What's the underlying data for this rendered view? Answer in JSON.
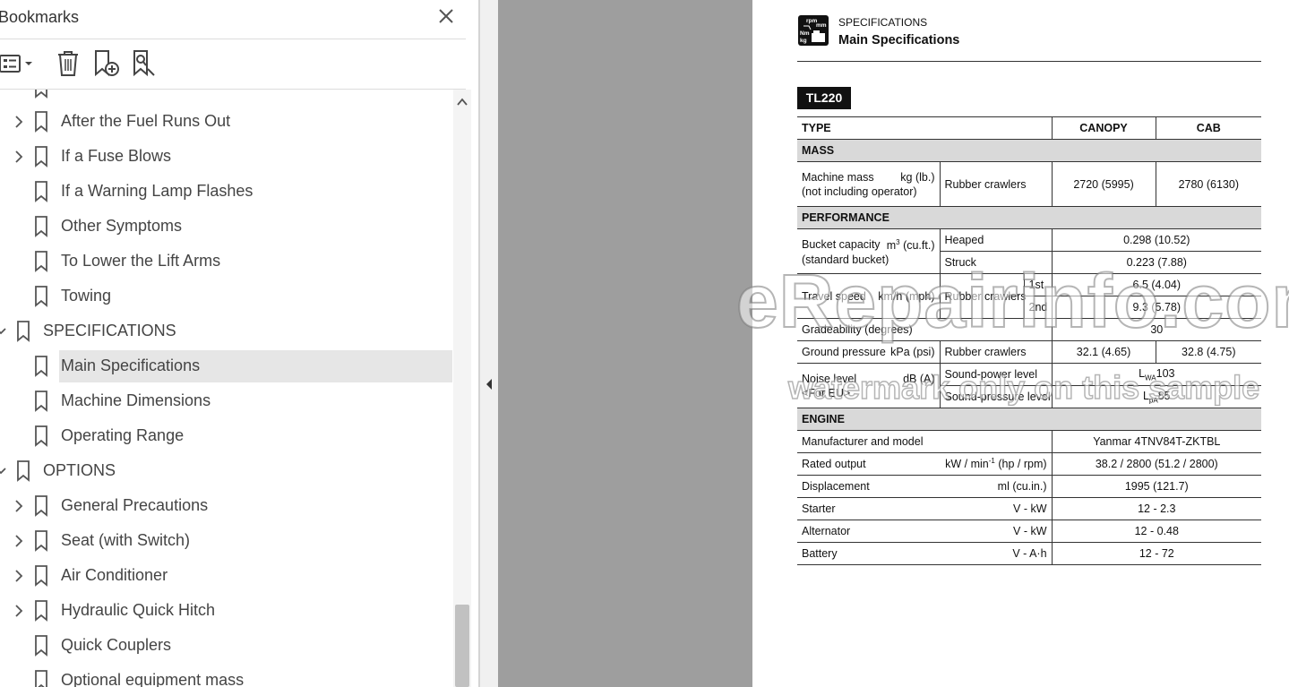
{
  "bookmarks_panel": {
    "title": "Bookmarks",
    "items": [
      {
        "label": "After the Fuel Runs Out",
        "level": 1,
        "expandable": true,
        "expanded": false,
        "selected": false
      },
      {
        "label": "If a Fuse Blows",
        "level": 1,
        "expandable": true,
        "expanded": false,
        "selected": false
      },
      {
        "label": "If a Warning Lamp Flashes",
        "level": 1,
        "expandable": false,
        "expanded": false,
        "selected": false
      },
      {
        "label": "Other Symptoms",
        "level": 1,
        "expandable": false,
        "expanded": false,
        "selected": false
      },
      {
        "label": "To Lower the Lift Arms",
        "level": 1,
        "expandable": false,
        "expanded": false,
        "selected": false
      },
      {
        "label": "Towing",
        "level": 1,
        "expandable": false,
        "expanded": false,
        "selected": false
      },
      {
        "label": "SPECIFICATIONS",
        "level": 0,
        "expandable": true,
        "expanded": true,
        "selected": false
      },
      {
        "label": "Main Specifications",
        "level": 1,
        "expandable": false,
        "expanded": false,
        "selected": true
      },
      {
        "label": "Machine Dimensions",
        "level": 1,
        "expandable": false,
        "expanded": false,
        "selected": false
      },
      {
        "label": "Operating Range",
        "level": 1,
        "expandable": false,
        "expanded": false,
        "selected": false
      },
      {
        "label": "OPTIONS",
        "level": 0,
        "expandable": true,
        "expanded": true,
        "selected": false
      },
      {
        "label": "General Precautions",
        "level": 1,
        "expandable": true,
        "expanded": false,
        "selected": false
      },
      {
        "label": "Seat (with Switch)",
        "level": 1,
        "expandable": true,
        "expanded": false,
        "selected": false
      },
      {
        "label": "Air Conditioner",
        "level": 1,
        "expandable": true,
        "expanded": false,
        "selected": false
      },
      {
        "label": "Hydraulic Quick Hitch",
        "level": 1,
        "expandable": true,
        "expanded": false,
        "selected": false
      },
      {
        "label": "Quick Couplers",
        "level": 1,
        "expandable": false,
        "expanded": false,
        "selected": false
      },
      {
        "label": "Optional equipment mass",
        "level": 1,
        "expandable": false,
        "expanded": false,
        "selected": false
      }
    ]
  },
  "document": {
    "icon_text": [
      "rpm",
      "mm",
      "Nm",
      "kg"
    ],
    "section": "SPECIFICATIONS",
    "title": "Main Specifications",
    "model": "TL220",
    "table": {
      "type_label": "TYPE",
      "canopy_label": "CANOPY",
      "cab_label": "CAB",
      "mass_section": "MASS",
      "machine_mass_label": "Machine mass",
      "machine_mass_unit": "kg (lb.)",
      "machine_mass_note": "(not including operator)",
      "machine_mass_variant": "Rubber crawlers",
      "machine_mass_canopy": "2720 (5995)",
      "machine_mass_cab": "2780 (6130)",
      "performance_section": "PERFORMANCE",
      "bucket_label": "Bucket capacity",
      "bucket_unit_pre": "m",
      "bucket_unit_sup": "3",
      "bucket_unit_post": " (cu.ft.)",
      "bucket_note": "(standard bucket)",
      "bucket_heaped_label": "Heaped",
      "bucket_heaped_value": "0.298 (10.52)",
      "bucket_struck_label": "Struck",
      "bucket_struck_value": "0.223 (7.88)",
      "travel_label": "Travel speed",
      "travel_unit": "km/h (mph)",
      "travel_variant": "Rubber crawlers",
      "travel_1st_label": "1st",
      "travel_1st_value": "6.5 (4.04)",
      "travel_2nd_label": "2nd",
      "travel_2nd_value": "9.3 (5.78)",
      "gradeability_label": "Gradeability (degrees)",
      "gradeability_value": "30",
      "ground_label": "Ground pressure",
      "ground_unit": "kPa (psi)",
      "ground_variant": "Rubber crawlers",
      "ground_canopy": "32.1 (4.65)",
      "ground_cab": "32.8 (4.75)",
      "noise_label": "Noise level",
      "noise_note": "<For EU>",
      "noise_unit": "dB (A)",
      "noise_power_label": "Sound-power level",
      "noise_power_pre": "L",
      "noise_power_sub": "WA",
      "noise_power_value": "103",
      "noise_pressure_label": "Sound-pressure level",
      "noise_pressure_pre": "L",
      "noise_pressure_sub": "pA",
      "noise_pressure_value": "85",
      "engine_section": "ENGINE",
      "engine_model_label": "Manufacturer and model",
      "engine_model_value": "Yanmar 4TNV84T-ZKTBL",
      "rated_label": "Rated output",
      "rated_unit_pre": "kW / min",
      "rated_unit_sup": "-1",
      "rated_unit_post": " (hp / rpm)",
      "rated_value": "38.2 / 2800 (51.2 / 2800)",
      "displacement_label": "Displacement",
      "displacement_unit": "ml (cu.in.)",
      "displacement_value": "1995 (121.7)",
      "starter_label": "Starter",
      "starter_unit": "V - kW",
      "starter_value": "12 - 2.3",
      "alternator_label": "Alternator",
      "alternator_unit": "V - kW",
      "alternator_value": "12 - 0.48",
      "battery_label": "Battery",
      "battery_unit": "V - A·h",
      "battery_value": "12 - 72"
    }
  },
  "watermark": {
    "line1": "eRepairinfo.com",
    "line2": "watermark only on this sample"
  }
}
